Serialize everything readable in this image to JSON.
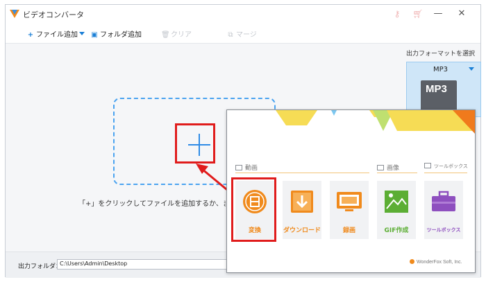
{
  "app": {
    "title": "ビデオコンバータ",
    "accent": "#1a7fd6"
  },
  "titlebar": {
    "icons": [
      "key-icon",
      "cart-icon"
    ],
    "controls": [
      "minimize",
      "close"
    ]
  },
  "toolbar": {
    "add_file": "ファイル追加",
    "add_folder": "フォルダ追加",
    "clear": "クリア",
    "merge": "マージ"
  },
  "drop_zone": {
    "hint": "「+」をクリックしてファイルを追加するか、またはフ"
  },
  "format_panel": {
    "label": "出力フォーマットを選択",
    "selected": "MP3",
    "file_badge": "MP3"
  },
  "bottom": {
    "output_label": "出力フォルダ：",
    "output_path": "C:\\Users\\Admin\\Desktop"
  },
  "launcher": {
    "categories": {
      "video": "動画",
      "image": "画像",
      "toolbox": "ツールボックス"
    },
    "tiles": [
      {
        "label": "変換",
        "color": "#f08a1c"
      },
      {
        "label": "ダウンロード",
        "color": "#f08a1c"
      },
      {
        "label": "録画",
        "color": "#f08a1c"
      },
      {
        "label": "GIF作成",
        "color": "#5cae34"
      },
      {
        "label": "ツールボックス",
        "color": "#8e4fbf"
      }
    ],
    "brand": "WonderFox Soft, Inc."
  },
  "colors": {
    "highlight": "#e01c1c",
    "dashed_border": "#4aa3f0"
  }
}
